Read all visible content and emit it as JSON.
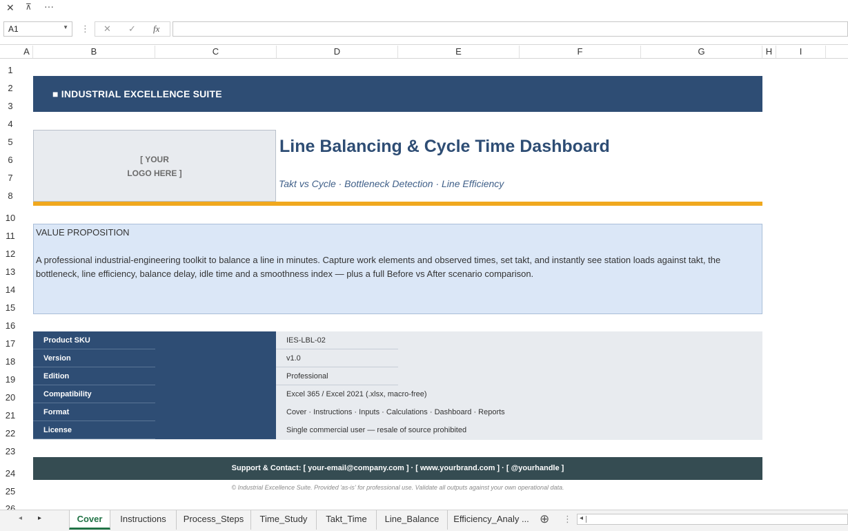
{
  "toolbar": {
    "close_icon": "✕",
    "pin_icon": "⊼",
    "more_icon": "···"
  },
  "formula_bar": {
    "name_box": "A1",
    "cancel_icon": "✕",
    "confirm_icon": "✓",
    "fx_label": "fx",
    "formula": ""
  },
  "columns": [
    "A",
    "B",
    "C",
    "D",
    "E",
    "F",
    "G",
    "H",
    "I"
  ],
  "rows": [
    "1",
    "2",
    "3",
    "4",
    "5",
    "6",
    "7",
    "8",
    "10",
    "11",
    "12",
    "13",
    "14",
    "15",
    "16",
    "17",
    "18",
    "19",
    "20",
    "21",
    "22",
    "23",
    "24",
    "25",
    "26"
  ],
  "sheet": {
    "banner": "■  INDUSTRIAL EXCELLENCE SUITE",
    "logo_line1": "[ YOUR",
    "logo_line2": "LOGO HERE ]",
    "title": "Line Balancing & Cycle Time Dashboard",
    "subtitle": "Takt vs Cycle · Bottleneck Detection · Line Efficiency",
    "value_prop_heading": "VALUE PROPOSITION",
    "value_prop_body": "A professional industrial-engineering toolkit to balance a line in minutes. Capture work elements and observed times, set takt, and instantly see station loads against takt, the bottleneck, line efficiency, balance delay, idle time and a smoothness index — plus a full Before vs After scenario comparison.",
    "meta": [
      {
        "label": "Product SKU",
        "value": "IES-LBL-02"
      },
      {
        "label": "Version",
        "value": "v1.0"
      },
      {
        "label": "Edition",
        "value": "Professional"
      },
      {
        "label": "Compatibility",
        "value": "Excel 365 / Excel 2021 (.xlsx, macro-free)"
      },
      {
        "label": "Format",
        "value": "Cover · Instructions · Inputs · Calculations · Dashboard · Reports"
      },
      {
        "label": "License",
        "value": "Single commercial user — resale of source prohibited"
      }
    ],
    "support": "Support & Contact:  [ your-email@company.com ]   ·   [ www.yourbrand.com ]   ·   [ @yourhandle ]",
    "copyright": "© Industrial Excellence Suite. Provided 'as-is' for professional use. Validate all outputs against your own operational data."
  },
  "tabs": [
    "Cover",
    "Instructions",
    "Process_Steps",
    "Time_Study",
    "Takt_Time",
    "Line_Balance",
    "Efficiency_Analy ..."
  ],
  "tab_nav": {
    "prev": "◂",
    "next": "▸",
    "add": "⊕",
    "more": "⋮",
    "scroll_left": "◂"
  },
  "colors": {
    "navy": "#2e4d74",
    "orange": "#f0a81e",
    "light_blue": "#dbe7f7",
    "footer": "#354c52",
    "excel_green": "#217346"
  }
}
